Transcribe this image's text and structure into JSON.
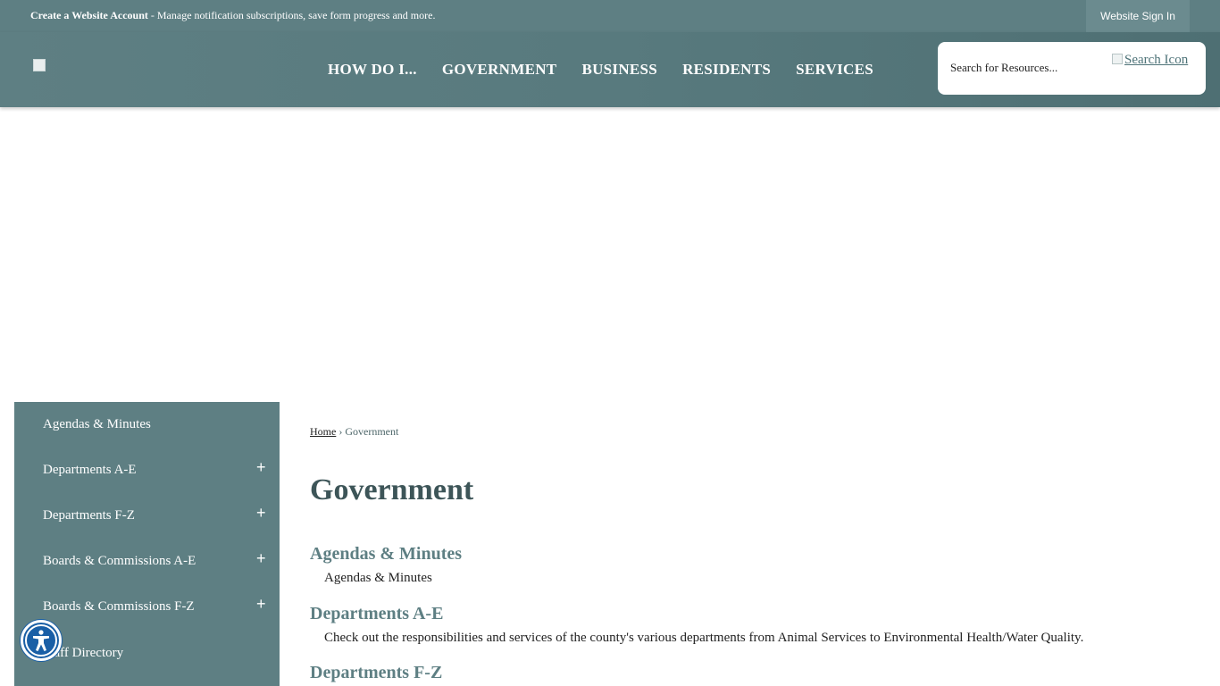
{
  "topbar": {
    "announce_strong": "Create a Website Account",
    "announce_rest": " - Manage notification subscriptions, save form progress and more.",
    "signin_label": "Website Sign In"
  },
  "nav": {
    "items": [
      "HOW DO I...",
      "GOVERNMENT",
      "BUSINESS",
      "RESIDENTS",
      "SERVICES"
    ]
  },
  "search": {
    "placeholder": "Search for Resources...",
    "icon_alt": "Search Icon"
  },
  "sidebar": {
    "items": [
      {
        "label": "Agendas & Minutes",
        "expandable": false
      },
      {
        "label": "Departments A-E",
        "expandable": true
      },
      {
        "label": "Departments F-Z",
        "expandable": true
      },
      {
        "label": "Boards & Commissions A-E",
        "expandable": true
      },
      {
        "label": "Boards & Commissions F-Z",
        "expandable": true
      },
      {
        "label": "Staff Directory",
        "expandable": false
      }
    ],
    "plus_symbol": "+"
  },
  "breadcrumb": {
    "home": "Home",
    "separator": "›",
    "current": "Government"
  },
  "main": {
    "title": "Government",
    "sections": [
      {
        "title": "Agendas & Minutes",
        "desc": "Agendas & Minutes"
      },
      {
        "title": "Departments A-E",
        "desc": "Check out the responsibilities and services of the county's various departments from Animal Services to Environmental Health/Water Quality."
      },
      {
        "title": "Departments F-Z",
        "desc": ""
      }
    ]
  },
  "colors": {
    "brand": "#5e7f83",
    "title": "#3d5558",
    "accessibility": "#1a5fa6"
  },
  "icons": {
    "accessibility": "accessibility-icon",
    "search": "search-icon",
    "expand": "plus-icon"
  }
}
